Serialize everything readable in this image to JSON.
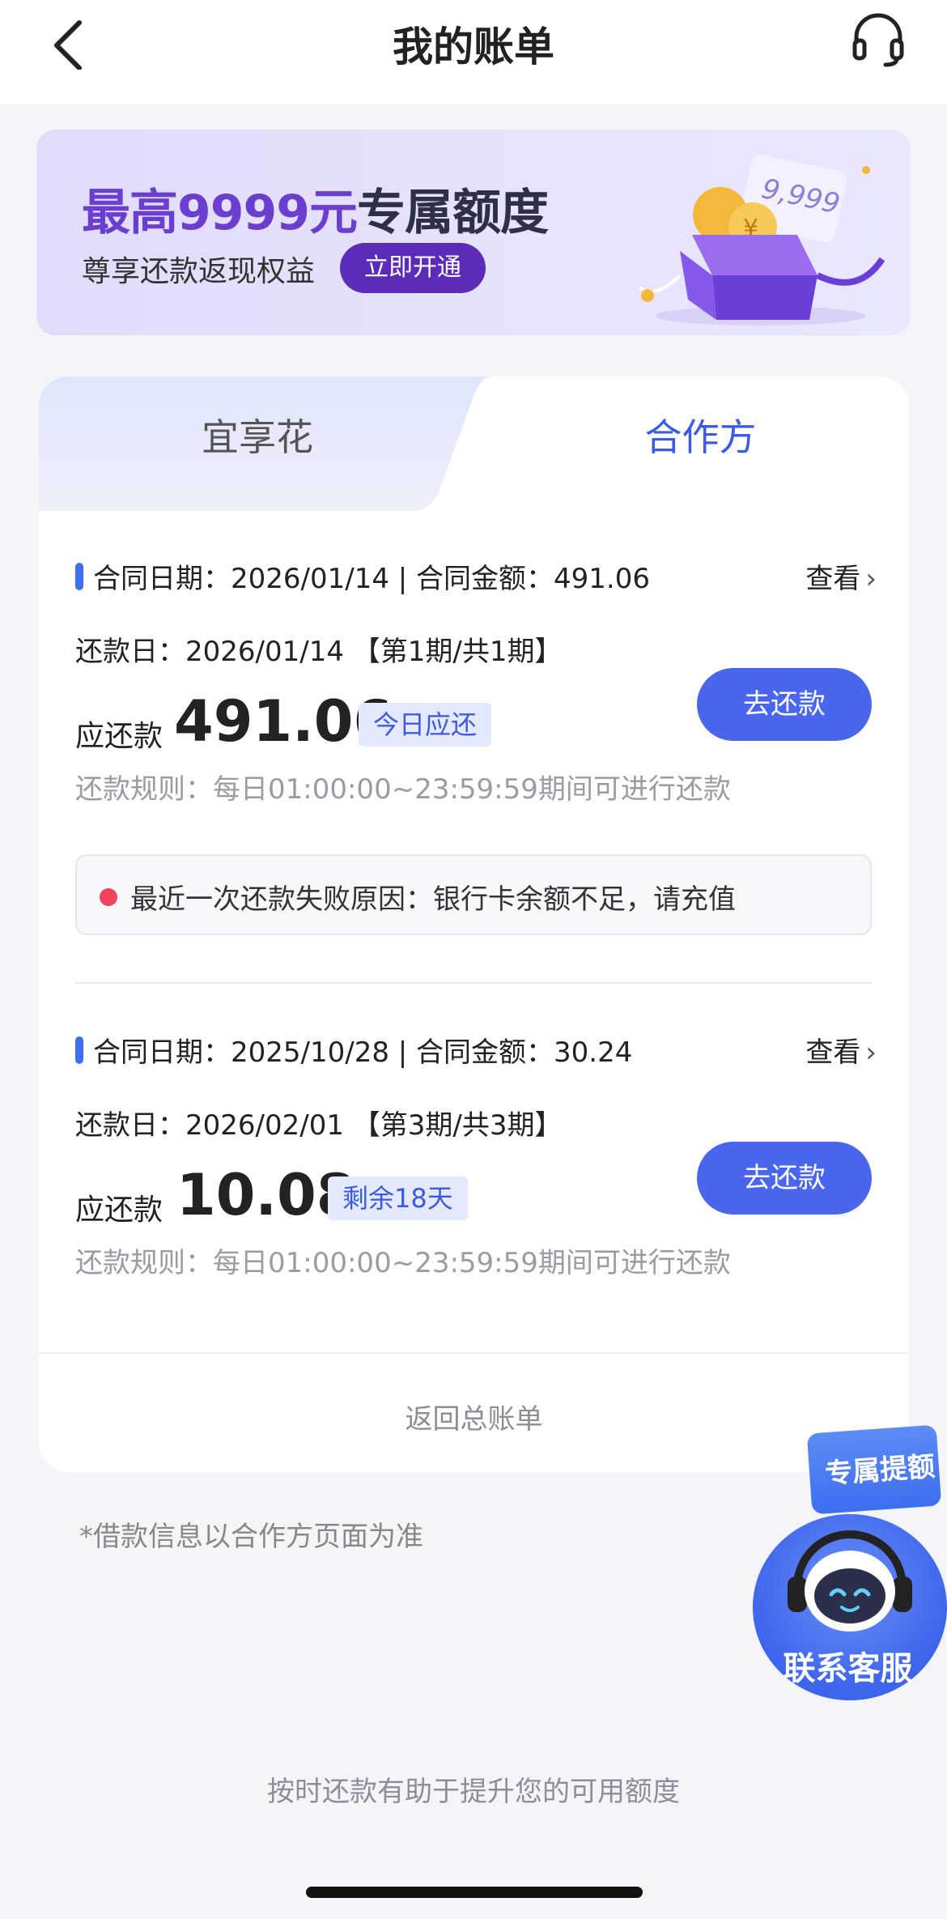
{
  "header": {
    "title": "我的账单",
    "back_icon": "chevron-left-icon",
    "support_icon": "headset-icon"
  },
  "banner": {
    "title_highlight": "最高9999元",
    "title_rest": "专属额度",
    "subtitle": "尊享还款返现权益",
    "button": "立即开通",
    "card_text": "9,999"
  },
  "tabs": [
    {
      "label": "宜享花",
      "active": false
    },
    {
      "label": "合作方",
      "active": true
    }
  ],
  "bills": [
    {
      "contract": "合同日期：2026/01/14 | 合同金额：491.06",
      "view": "查看",
      "due_date": "还款日：2026/01/14  【第1期/共1期】",
      "due_label": "应还款",
      "amount": "491.06",
      "tag": "今日应还",
      "pay_button": "去还款",
      "rule": "还款规则：每日01:00:00~23:59:59期间可进行还款",
      "failure": "最近一次还款失败原因：银行卡余额不足，请充值"
    },
    {
      "contract": "合同日期：2025/10/28 | 合同金额：30.24",
      "view": "查看",
      "due_date": "还款日：2026/02/01  【第3期/共3期】",
      "due_label": "应还款",
      "amount": "10.08",
      "tag": "剩余18天",
      "pay_button": "去还款",
      "rule": "还款规则：每日01:00:00~23:59:59期间可进行还款"
    }
  ],
  "back_total": "返回总账单",
  "note": "*借款信息以合作方页面为准",
  "bottom_tip": "按时还款有助于提升您的可用额度",
  "float": {
    "tag": "专属提额",
    "label": "联系客服"
  },
  "colors": {
    "accent": "#4a66ee",
    "banner_accent": "#5b2cb8",
    "error_dot": "#f0435d"
  }
}
